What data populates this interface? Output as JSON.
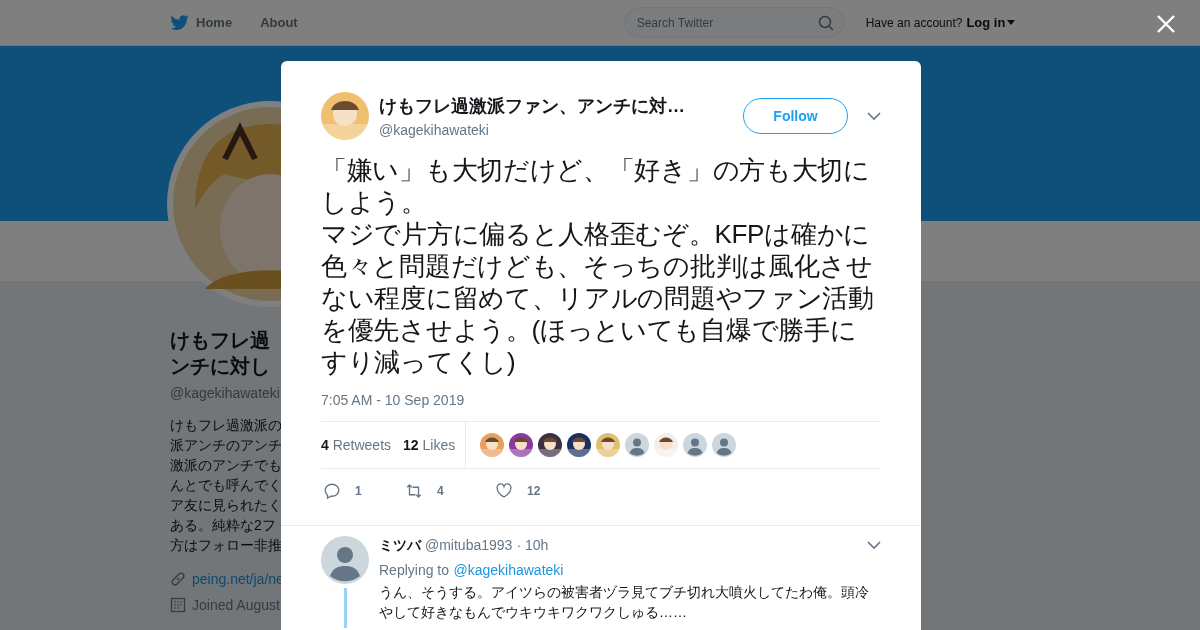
{
  "nav": {
    "items": [
      {
        "label": "Home",
        "kind": "home"
      },
      {
        "label": "About",
        "kind": "plain"
      }
    ],
    "search": {
      "placeholder": "Search Twitter"
    },
    "account_prompt": "Have an account?",
    "login": "Log in"
  },
  "profile": {
    "name_lines": [
      "けもフレ過",
      "ンチに対し"
    ],
    "handle": "@kagekihawateki",
    "bio_lines": [
      "けもフレ過激派の",
      "派アンチのアンチ",
      "激派のアンチでも",
      "んとでも呼んでく",
      "ア友に見られたく",
      "ある。純粋な2フ",
      "方はフォロー非推"
    ],
    "link": "peing.net/ja/ne",
    "joined": "Joined August"
  },
  "tweet": {
    "author": "けもフレ過激派ファン、アンチに対…",
    "handle": "@kagekihawateki",
    "follow": "Follow",
    "paragraphs": [
      "「嫌い」も大切だけど、「好き」の方も大切にしよう。",
      "マジで片方に偏ると人格歪むぞ。KFPは確かに色々と問題だけども、そっちの批判は風化させない程度に留めて、リアルの問題やファン活動を優先させよう。(ほっといても自爆で勝手にすり減ってくし)"
    ],
    "time": "7:05 AM - 10 Sep 2019",
    "stats": [
      {
        "count": "4",
        "label": "Retweets"
      },
      {
        "count": "12",
        "label": "Likes"
      }
    ],
    "likers": [
      {
        "kind": "picture"
      },
      {
        "kind": "picture"
      },
      {
        "kind": "picture"
      },
      {
        "kind": "picture"
      },
      {
        "kind": "picture"
      },
      {
        "kind": "default"
      },
      {
        "kind": "picture"
      },
      {
        "kind": "default"
      },
      {
        "kind": "default"
      }
    ],
    "actions": [
      {
        "kind": "reply",
        "count": "1"
      },
      {
        "kind": "retweet",
        "count": "4"
      },
      {
        "kind": "like",
        "count": "12"
      }
    ]
  },
  "reply": {
    "name": "ミツバ",
    "handle": "@mituba1993",
    "time": "· 10h",
    "replying_prefix": "Replying to",
    "replying_to": "@kagekihawateki",
    "text": "うん、そうする。アイツらの被害者ヅラ見てブチ切れ大噴火してたわ俺。頭冷やして好きなもんでウキウキワクワクしゅる……"
  }
}
